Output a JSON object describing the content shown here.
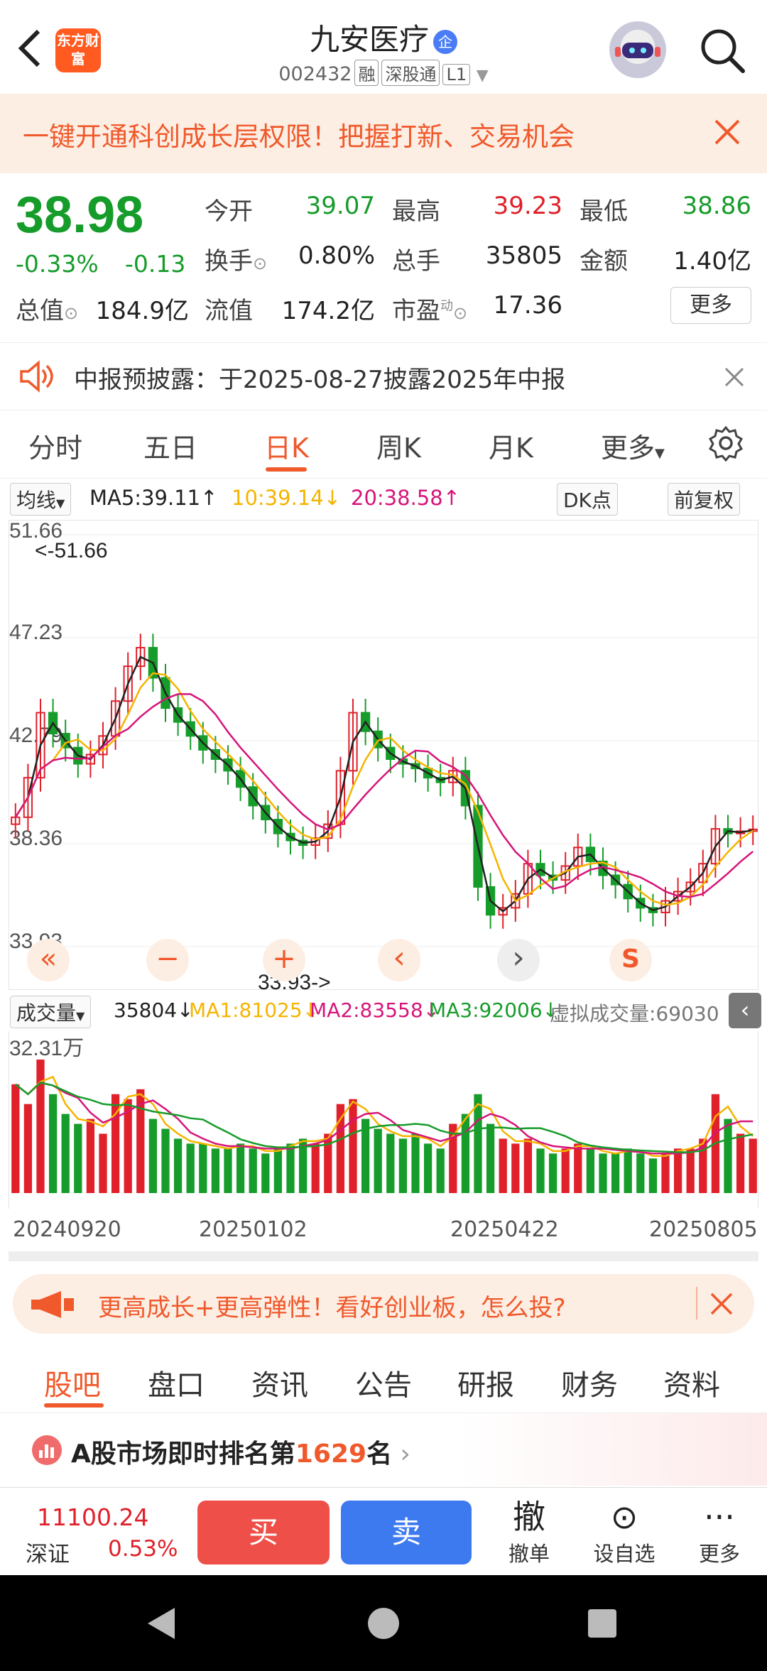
{
  "header": {
    "logo_text": "东方财富",
    "stock_name": "九安医疗",
    "badge": "企",
    "code": "002432",
    "tags": [
      "融",
      "深股通",
      "L1"
    ]
  },
  "promo": {
    "text": "一键开通科创成长层权限！把握打新、交易机会"
  },
  "quote": {
    "price": "38.98",
    "change_pct": "-0.33%",
    "change_amt": "-0.13",
    "fields": {
      "open_label": "今开",
      "open": "39.07",
      "high_label": "最高",
      "high": "39.23",
      "low_label": "最低",
      "low": "38.86",
      "turnover_label": "换手",
      "turnover": "0.80%",
      "volume_label": "总手",
      "volume": "35805",
      "amount_label": "金额",
      "amount": "1.40亿",
      "mktcap_label": "总值",
      "mktcap": "184.9亿",
      "float_label": "流值",
      "float": "174.2亿",
      "pe_label": "市盈",
      "pe_sup": "动",
      "pe": "17.36"
    },
    "more_label": "更多"
  },
  "notice": {
    "text": "中报预披露：于2025-08-27披露2025年中报"
  },
  "chart_tabs": [
    "分时",
    "五日",
    "日K",
    "周K",
    "月K",
    "更多"
  ],
  "chart_tabs_active": "日K",
  "ma_legend": {
    "selector": "均线",
    "ma5": "MA5:39.11",
    "ma10": "10:39.14",
    "ma20": "20:38.58",
    "dk": "DK点",
    "adjust": "前复权"
  },
  "colors": {
    "up": "#e0202a",
    "down": "#169c2a",
    "ma5": "#222222",
    "ma10": "#f5b400",
    "ma20": "#d6157a",
    "accent": "#f0592b"
  },
  "vol_legend": {
    "selector": "成交量",
    "vol": "35804",
    "ma1": "MA1:81025",
    "ma2": "MA2:83558",
    "ma3": "MA3:92006",
    "virtual": "虚拟成交量:69030"
  },
  "chart_data": {
    "type": "candlestick",
    "y_ticks": [
      "51.66",
      "47.23",
      "42.79",
      "38.36",
      "33.93"
    ],
    "ylim": [
      33.93,
      51.66
    ],
    "max_label": "<-51.66",
    "min_label": "33.93->",
    "vol_max_label": "32.31万",
    "x_dates": [
      "20240920",
      "20250102",
      "20250422",
      "20250805"
    ],
    "closes": [
      39.5,
      41.2,
      44.0,
      43.1,
      42.5,
      41.8,
      42.2,
      43.0,
      44.5,
      46.0,
      46.8,
      45.5,
      44.2,
      43.6,
      43.0,
      42.4,
      42.0,
      41.5,
      40.8,
      40.0,
      39.4,
      38.8,
      38.5,
      38.3,
      38.6,
      39.2,
      41.5,
      44.0,
      43.2,
      42.5,
      42.0,
      41.8,
      41.6,
      41.2,
      41.0,
      41.5,
      40.0,
      36.5,
      35.3,
      35.6,
      36.2,
      37.5,
      37.0,
      36.8,
      37.4,
      38.2,
      37.6,
      37.0,
      36.6,
      36.0,
      35.6,
      35.4,
      35.9,
      36.3,
      36.7,
      37.5,
      39.0,
      38.8,
      38.9,
      38.98
    ],
    "volumes": [
      22,
      18,
      27,
      20,
      16,
      14,
      15,
      12,
      20,
      19,
      21,
      15,
      13,
      11,
      10,
      10,
      9,
      9,
      10,
      9,
      8,
      9,
      10,
      11,
      10,
      12,
      18,
      19,
      15,
      13,
      12,
      11,
      12,
      10,
      9,
      14,
      16,
      20,
      14,
      11,
      10,
      11,
      9,
      8,
      9,
      10,
      9,
      8,
      8,
      9,
      8,
      7,
      8,
      9,
      9,
      11,
      20,
      15,
      12,
      11
    ]
  },
  "controls": [
    "«",
    "−",
    "+",
    "‹",
    "›",
    "S"
  ],
  "ad": {
    "text": "更高成长+更高弹性！看好创业板，怎么投?"
  },
  "bottom_tabs": [
    "股吧",
    "盘口",
    "资讯",
    "公告",
    "研报",
    "财务",
    "资料"
  ],
  "bottom_tabs_active": "股吧",
  "rank": {
    "prefix": "A股市场即时排名第",
    "rank": "1629",
    "suffix": "名"
  },
  "trade": {
    "index_value": "11100.24",
    "index_name": "深证",
    "index_pct": "0.53%",
    "buy": "买",
    "sell": "卖",
    "tools": [
      {
        "icon": "撤",
        "label": "撤单"
      },
      {
        "icon": "⊙",
        "label": "设自选"
      },
      {
        "icon": "···",
        "label": "更多"
      }
    ]
  }
}
